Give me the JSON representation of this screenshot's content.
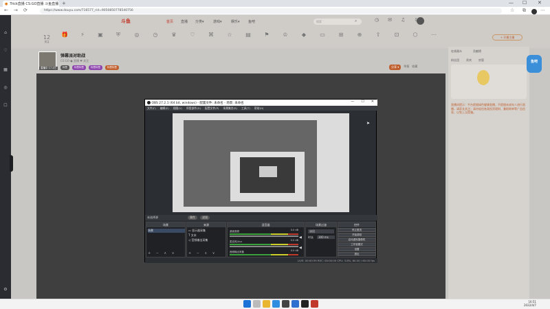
{
  "browser": {
    "tab_title": "Trick直播 CS:GO直播 斗鱼直播",
    "new_tab": "+",
    "url": "https://www.douyu.com/716577_rid=9050850778540756",
    "window_controls": [
      "—",
      "☐",
      "✕"
    ]
  },
  "site": {
    "logo_text": "斗鱼",
    "nav": [
      "首页",
      "直播",
      "分类▾",
      "游戏▾",
      "娱乐▾",
      "鱼吧"
    ],
    "search_placeholder": "搜索",
    "icon_row": [
      "12",
      "关注",
      "…",
      "赛事",
      "直播",
      "分类",
      "…",
      "…",
      "…",
      "…",
      "…",
      "…",
      "…",
      "…",
      "…",
      "…",
      "…",
      "…",
      "…",
      "…",
      "…",
      "…"
    ],
    "live_button": "+ 开播主播"
  },
  "streamer": {
    "title": "弹幕派对助战",
    "meta": "CS:GO  ● 直播  ♥ 关注",
    "thumb_tag": "直播中 17.4万",
    "tags": [
      "标签",
      "标签标签",
      "标签标签",
      "标签标签"
    ],
    "right_buttons": [
      "分享 ▾",
      "举报",
      "收藏"
    ]
  },
  "right_panel": {
    "header": [
      "在线观众",
      "贡献榜"
    ],
    "tabs": [
      "粉丝团",
      "贵宾",
      "房管"
    ],
    "note": "直播间提示：平台提倡绿色健康直播，不提倡未成年人进行直播，请家长关注；请勿轻信各类投资理财、兼职刷单等广告信息，以免上当受骗。",
    "float_badge": "鱼吧"
  },
  "obs": {
    "title": "OBS 27.2.1 (64 bit, windows) - 配置文件: 未命名 - 场景: 未命名",
    "controls": [
      "—",
      "☐",
      "✕"
    ],
    "menu": [
      "文件(F)",
      "编辑(E)",
      "视图(V)",
      "停靠部件(D)",
      "配置文件(P)",
      "场景集合(S)",
      "工具(T)",
      "帮助(H)"
    ],
    "scene_bar_label": "未选择源",
    "scene_bar_buttons": [
      "属性",
      "滤镜"
    ],
    "docks": {
      "scenes_title": "场景",
      "scene_item": "场景",
      "sources_title": "来源",
      "sources": [
        "显示器采集",
        "文本",
        "音频输出采集"
      ],
      "mixer_title": "混音器",
      "mixer": [
        {
          "name": "桌面音频",
          "db": "0.0 dB"
        },
        {
          "name": "麦克风/Aux",
          "db": "0.0 dB"
        },
        {
          "name": "音频输出采集",
          "db": "0.0 dB"
        }
      ],
      "transitions_title": "场景过渡",
      "transition": "淡出",
      "duration_label": "时长",
      "duration": "300 ms",
      "controls_title": "控件",
      "controls": [
        "停止推流",
        "开始录制",
        "启动虚拟摄像机",
        "工作室模式",
        "设置",
        "退出"
      ],
      "footer": "+ − ∧ ∨"
    },
    "status": "LIVE: 00:00:39   REC: 00:00:00   CPU: 3.8%, 60.00 / 60.00 fps"
  },
  "taskbar": {
    "time": "16:51",
    "date": "2022/4/7"
  },
  "colors": {
    "accent": "#c0602f",
    "obs_bg": "#2b2e33",
    "sidebar": "#2a2c31"
  }
}
